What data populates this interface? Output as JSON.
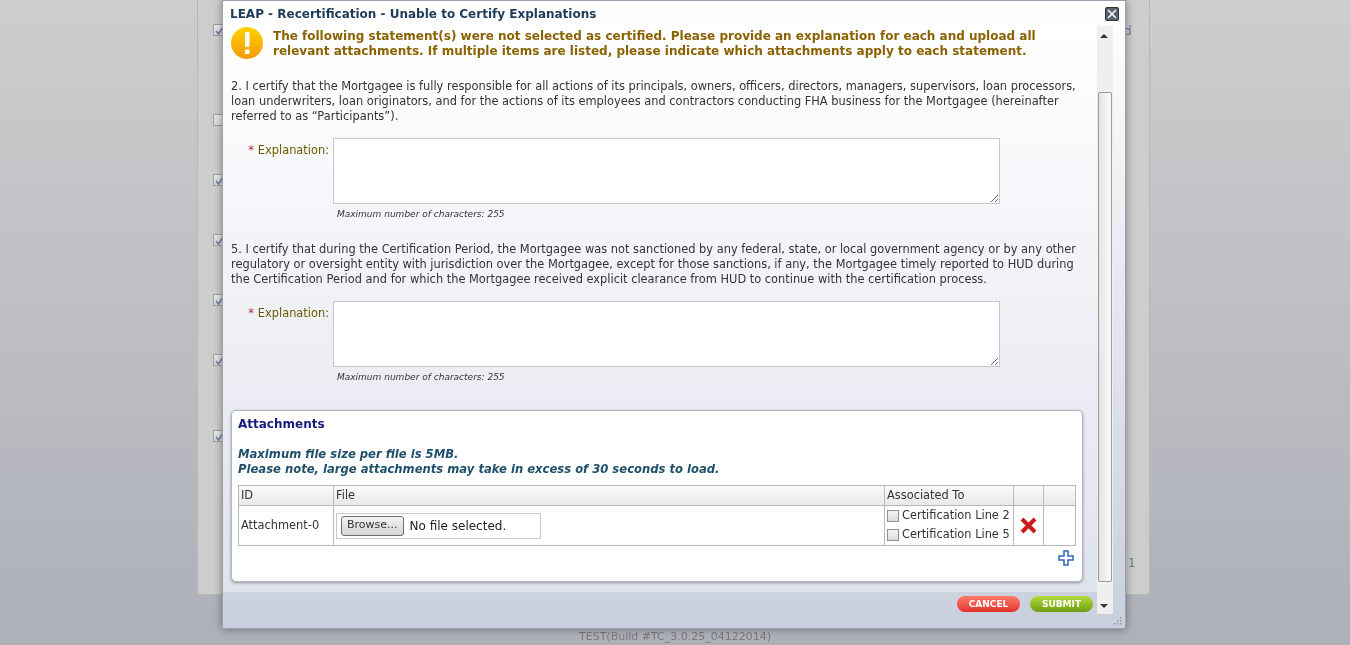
{
  "background_page": {
    "checkboxes": [
      {
        "checked": true
      },
      {
        "checked": false
      },
      {
        "checked": true
      },
      {
        "checked": true
      },
      {
        "checked": true
      },
      {
        "checked": true
      },
      {
        "checked": true
      }
    ],
    "fragments": [
      "d",
      "1"
    ],
    "footer": "TEST(Build #TC_3.0.25_04122014)"
  },
  "dialog": {
    "title": "LEAP - Recertification - Unable to Certify Explanations",
    "warning": "The following statement(s) were not selected as certified. Please provide an explanation for each and upload all relevant attachments. If multiple items are listed, please indicate which attachments apply to each statement.",
    "statements": [
      {
        "text": "2. I certify that the Mortgagee is fully responsible for all actions of its principals, owners, officers, directors, managers, supervisors, loan processors, loan underwriters, loan originators, and for the actions of its employees and contractors conducting FHA business for the Mortgagee (hereinafter referred to as “Participants”).",
        "required_mark": "*",
        "label": "Explanation:",
        "hint": "Maximum number of characters: 255"
      },
      {
        "text": "5. I certify that during the Certification Period, the Mortgagee was not sanctioned by any federal, state, or local government agency or by any other regulatory or oversight entity with jurisdiction over the Mortgagee, except for those sanctions, if any, the Mortgagee timely reported to HUD during the Certification Period and for which the Mortgagee received explicit clearance from HUD to continue with the certification process.",
        "required_mark": "*",
        "label": "Explanation:",
        "hint": "Maximum number of characters: 255"
      }
    ],
    "attachments": {
      "title": "Attachments",
      "notes": [
        "Maximum file size per file is 5MB.",
        "Please note, large attachments may take in excess of 30 seconds to load."
      ],
      "columns": [
        "ID",
        "File",
        "Associated To"
      ],
      "rows": [
        {
          "id": "Attachment-0",
          "browse": "Browse...",
          "file_status": "No file selected.",
          "associations": [
            {
              "label": "Certification Line 2",
              "checked": false
            },
            {
              "label": "Certification Line 5",
              "checked": false
            }
          ]
        }
      ]
    },
    "buttons": [
      {
        "label": "CANCEL",
        "kind": "cancel"
      },
      {
        "label": "SUBMIT",
        "kind": "submit"
      }
    ]
  }
}
